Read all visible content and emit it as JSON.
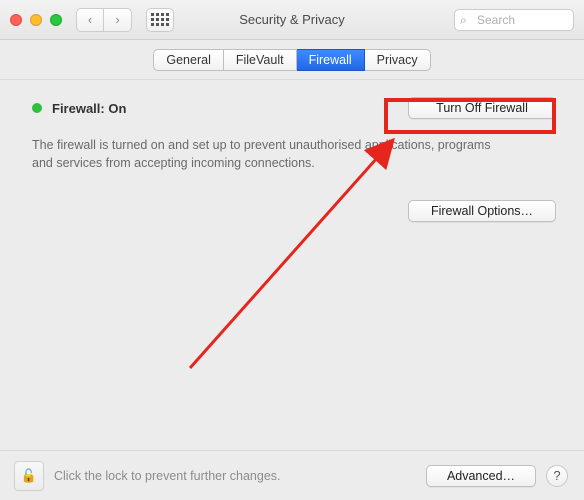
{
  "window": {
    "title": "Security & Privacy"
  },
  "search": {
    "placeholder": "Search"
  },
  "tabs": [
    {
      "label": "General"
    },
    {
      "label": "FileVault"
    },
    {
      "label": "Firewall",
      "active": true
    },
    {
      "label": "Privacy"
    }
  ],
  "firewall": {
    "status_label": "Firewall: On",
    "status_color": "#2fbf3a",
    "turn_off_label": "Turn Off Firewall",
    "description": "The firewall is turned on and set up to prevent unauthorised applications, programs and services from accepting incoming connections.",
    "options_label": "Firewall Options…"
  },
  "footer": {
    "lock_hint": "Click the lock to prevent further changes.",
    "advanced_label": "Advanced…",
    "help_label": "?"
  },
  "icons": {
    "back": "‹",
    "forward": "›",
    "search": "⌕",
    "lock": "🔓"
  },
  "annotation": {
    "kind": "red-rectangle+arrow",
    "target": "turn-off-firewall-button"
  }
}
